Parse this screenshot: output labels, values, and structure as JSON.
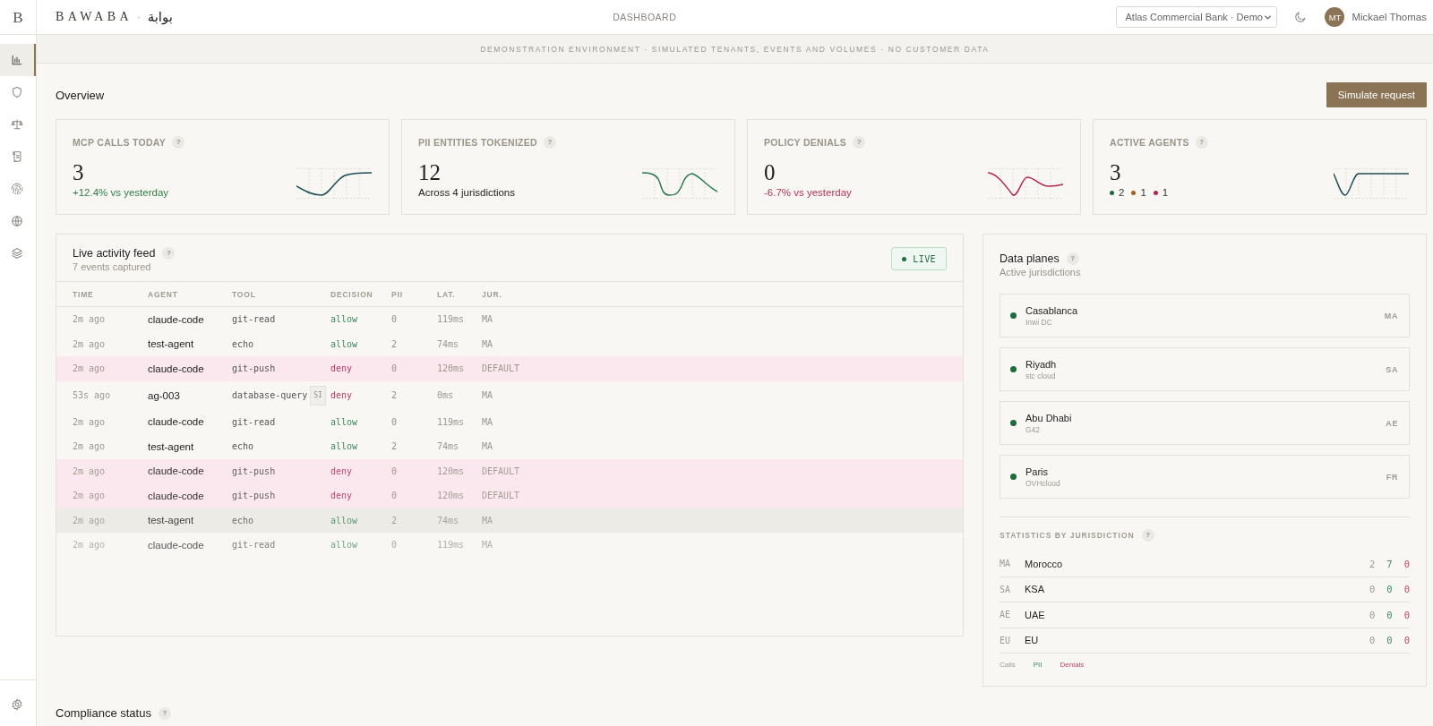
{
  "brand": {
    "logo_mark": "B",
    "name": "BAWABA",
    "separator": "·",
    "name_arabic": "بوابة"
  },
  "sidebar": {
    "items": [
      {
        "selected": true
      },
      {
        "selected": false
      },
      {
        "selected": false
      },
      {
        "selected": false
      },
      {
        "selected": false
      },
      {
        "selected": false
      },
      {
        "selected": false
      }
    ],
    "footer_items": [
      {
        "selected": false
      }
    ]
  },
  "topbar": {
    "title": "DASHBOARD",
    "tenant_select": {
      "value": "Atlas Commercial Bank · Demo"
    },
    "user": {
      "initials": "MT",
      "name": "Mickael Thomas"
    }
  },
  "banner": {
    "text": "DEMONSTRATION ENVIRONMENT · SIMULATED TENANTS, EVENTS AND VOLUMES · NO CUSTOMER DATA"
  },
  "overview": {
    "title": "Overview",
    "action": "Simulate request",
    "stat_cards": [
      {
        "title": "MCP CALLS TODAY",
        "help": "?",
        "value": "3",
        "note": "+12.4% vs yesterday",
        "positive": true
      },
      {
        "title": "PII ENTITIES TOKENIZED",
        "help": "?",
        "value": "12",
        "note": "Across 4 jurisdictions"
      },
      {
        "title": "POLICY DENIALS",
        "help": "?",
        "value": "0",
        "note": "-6.7% vs yesterday",
        "positive": false
      },
      {
        "title": "ACTIVE AGENTS",
        "help": "?",
        "value": "3",
        "breakdown": [
          {
            "count": "2",
            "color": "#1e6b3b"
          },
          {
            "count": "1",
            "color": "#a65d1e"
          },
          {
            "count": "1",
            "color": "#b0284f"
          }
        ]
      }
    ]
  },
  "feed": {
    "title": "Live activity feed",
    "help": "?",
    "subtitle": "7 events captured",
    "live": {
      "label": "LIVE",
      "on": true
    },
    "columns": [
      "TIME",
      "AGENT",
      "TOOL",
      "DECISION",
      "PII",
      "LAT.",
      "JUR."
    ],
    "rows": [
      {
        "time": "2m ago",
        "agent": "claude-code",
        "tool": "git-read",
        "decision": "allow",
        "pii": "0",
        "latency": "119ms",
        "jurisdiction": "MA",
        "denied": false,
        "flagged": false,
        "hovered": false
      },
      {
        "time": "2m ago",
        "agent": "test-agent",
        "tool": "echo",
        "decision": "allow",
        "pii": "2",
        "latency": "74ms",
        "jurisdiction": "MA",
        "denied": false,
        "flagged": false,
        "hovered": false
      },
      {
        "time": "2m ago",
        "agent": "claude-code",
        "tool": "git-push",
        "decision": "deny",
        "pii": "0",
        "latency": "120ms",
        "jurisdiction": "DEFAULT",
        "denied": true,
        "flagged": true,
        "hovered": false
      },
      {
        "time": "53s ago",
        "agent": "ag-003",
        "tool": "database-query",
        "tag": "SI",
        "decision": "deny",
        "pii": "2",
        "latency": "0ms",
        "jurisdiction": "MA",
        "denied": true,
        "flagged": false,
        "hovered": false
      },
      {
        "time": "2m ago",
        "agent": "claude-code",
        "tool": "git-read",
        "decision": "allow",
        "pii": "0",
        "latency": "119ms",
        "jurisdiction": "MA",
        "denied": false,
        "flagged": false,
        "hovered": false
      },
      {
        "time": "2m ago",
        "agent": "test-agent",
        "tool": "echo",
        "decision": "allow",
        "pii": "2",
        "latency": "74ms",
        "jurisdiction": "MA",
        "denied": false,
        "flagged": false,
        "hovered": false
      },
      {
        "time": "2m ago",
        "agent": "claude-code",
        "tool": "git-push",
        "decision": "deny",
        "pii": "0",
        "latency": "120ms",
        "jurisdiction": "DEFAULT",
        "denied": true,
        "flagged": true,
        "hovered": false
      },
      {
        "time": "2m ago",
        "agent": "claude-code",
        "tool": "git-push",
        "decision": "deny",
        "pii": "0",
        "latency": "120ms",
        "jurisdiction": "DEFAULT",
        "denied": true,
        "flagged": true,
        "hovered": false
      },
      {
        "time": "2m ago",
        "agent": "test-agent",
        "tool": "echo",
        "decision": "allow",
        "pii": "2",
        "latency": "74ms",
        "jurisdiction": "MA",
        "denied": false,
        "flagged": false,
        "hovered": true
      },
      {
        "time": "2m ago",
        "agent": "claude-code",
        "tool": "git-read",
        "decision": "allow",
        "pii": "0",
        "latency": "119ms",
        "jurisdiction": "MA",
        "denied": false,
        "flagged": false,
        "hovered": false
      }
    ]
  },
  "data_planes": {
    "title": "Data planes",
    "help": "?",
    "subtitle": "Active jurisdictions",
    "planes": [
      {
        "city": "Casablanca",
        "provider": "Inwi DC",
        "code": "MA",
        "online": true
      },
      {
        "city": "Riyadh",
        "provider": "stc cloud",
        "code": "SA",
        "online": true
      },
      {
        "city": "Abu Dhabi",
        "provider": "G42",
        "code": "AE",
        "online": true
      },
      {
        "city": "Paris",
        "provider": "OVHcloud",
        "code": "FR",
        "online": true
      }
    ],
    "statistics": {
      "title": "STATISTICS BY JURISDICTION",
      "help": "?",
      "rows": [
        {
          "code": "MA",
          "name": "Morocco",
          "calls": "2",
          "pii": "7",
          "denials": "0"
        },
        {
          "code": "SA",
          "name": "KSA",
          "calls": "0",
          "pii": "0",
          "denials": "0"
        },
        {
          "code": "AE",
          "name": "UAE",
          "calls": "0",
          "pii": "0",
          "denials": "0"
        },
        {
          "code": "EU",
          "name": "EU",
          "calls": "0",
          "pii": "0",
          "denials": "0"
        }
      ],
      "legend": {
        "calls": "Calls",
        "pii": "PII",
        "denials": "Denials"
      }
    }
  },
  "compliance": {
    "title": "Compliance status",
    "help": "?"
  }
}
